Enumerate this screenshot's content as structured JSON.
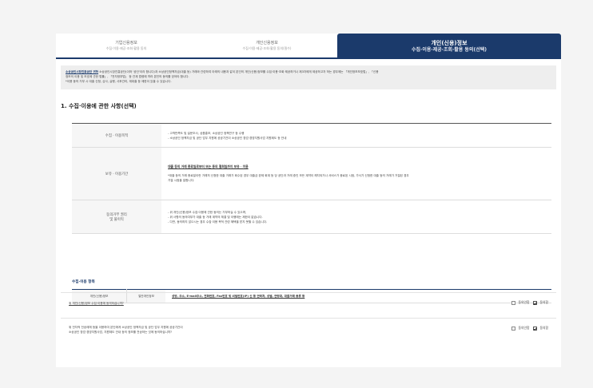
{
  "tabs": [
    {
      "title": "기업신용정보",
      "subtitle": "수집·이용·제공·조회·활용 동의"
    },
    {
      "title": "개인신용정보",
      "subtitle": "수집·이용·제공·조회·활용 동의(필수)"
    },
    {
      "title": "개인(신용)정보",
      "subtitle": "수집·이용·제공·조회·활용 동의(선택)"
    }
  ],
  "notice": {
    "lead": "소상공인시장진흥공단 귀하",
    "line1": " 소상공인시장진흥공단(이하 '공단'이라 합니다)과 소상공인정책자금(대출 등) 거래와 관련하여 아래의 내용과 같이 본인의 개인(신용)정보를 수집·이용·조회·제공하거나 제3자에게 제공하고자 하는 경우에는 「개인정보보호법」, 「신용",
    "line2": "정보의 이용 및 보호에 관한 법률」, 「전자정부법」 등 관계 법령에 따라 본인의 동의를 얻어야 합니다.",
    "line3": "*이용 동의 거부 시 대출 신청, 심사, 실행, 사후관리, 재대출 등 제한이 있을 수 있습니다."
  },
  "section_title": "1. 수집·이용에 관한 사항(선택)",
  "rows": [
    {
      "head": "수집 · 이용목적",
      "lines": [
        "- 고객만족도 및 설문조사, 상품홍보, 소상공인 정책연구 등 수행",
        "- 소상공인 정책자금 및 공단 업무 지원에 공공기관이 소상공인 창업·경영지원사업 지원제도 등 안내"
      ]
    },
    {
      "head": "보유 · 이용기간",
      "link": "대출 등의 거래 종료일로부터 또는 동의 철회일까지 보유 · 이용",
      "lines": [
        "*대출 등의 거래 종료일이란 거래처 신청한 대출 거래가 회수된 경우 대출금 완제 회계 등 당 공단과 거래 중인 모든 계약이 해지되거나 서비스가 종료된 시점, 가서가 신청한 대출 등의 거래가 거절된 경우",
        "거절 시점을 말합니다."
      ]
    },
    {
      "head": "동의거부 권리\n및 불이익",
      "lines": [
        "- 위 개인(신용)정보 수집·이용에 관한 동의는 거부하실 수 있으며,",
        "- 위 사항의 동의여부가 대출 등 거래 계약의 체결 및 이행에는 제한이 없습니다.",
        "- 다만, 동의하지 않으시는 경우 수집·이용 목적 관련 혜택을 받지 못할 수 있습니다."
      ]
    }
  ],
  "items_title": "수집·이용 항목",
  "items": {
    "category": "개인(신용)정보",
    "type": "일반개인정보",
    "value": "성명, 주소, E-mail주소, 전화번호, Fax번호 및 비밀번호(IP) 신 등 연락처, 성별, 연령대, 대출거래 종류 등"
  },
  "consents": [
    {
      "question": "위 개인(신용)정보 수집·이용에 동의하십니까?",
      "line2": "",
      "disagree": "동의안함",
      "agree": "동의함"
    },
    {
      "question": "위 전자적 전송매체 등을 이용하여 본인에게 소상공인 정책자금 및 공단 업무 지원에 공공기관이",
      "line2": "소상공인 창업·경영지원사업, 지원제도 안내 등의 정보를 전송하는 것에 동의하십니까?",
      "disagree": "동의안함",
      "agree": "동의함"
    }
  ],
  "colors": {
    "primary": "#1b3a6b",
    "background": "#f4f4f4"
  }
}
